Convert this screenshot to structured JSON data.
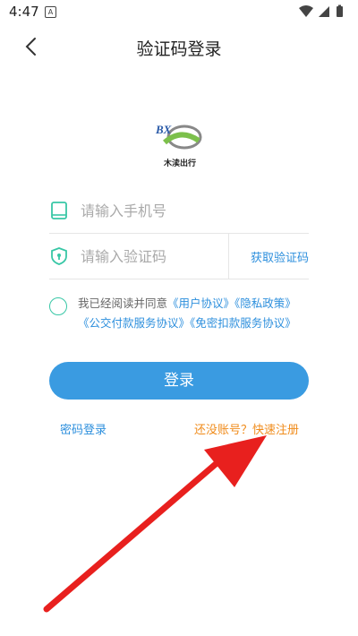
{
  "status_bar": {
    "time": "4:47",
    "notification_glyph": "A"
  },
  "header": {
    "title": "验证码登录"
  },
  "logo": {
    "text": "木渎出行",
    "letters": "BX"
  },
  "phone_field": {
    "placeholder": "请输入手机号",
    "value": ""
  },
  "code_field": {
    "placeholder": "请输入验证码",
    "value": ""
  },
  "get_code_label": "获取验证码",
  "agreement": {
    "prefix": "我已经阅读并同意",
    "user_agreement": "《用户协议》",
    "privacy_policy": "《隐私政策》",
    "bus_payment_agreement": "《公交付款服务协议》",
    "password_free_agreement": "《免密扣款服务协议》",
    "checked": false
  },
  "login_button": "登录",
  "password_login_link": "密码登录",
  "register_link": "还没账号？快速注册",
  "colors": {
    "accent_blue": "#3a9be1",
    "link_blue": "#2d8fdd",
    "register_orange": "#f08c1c",
    "check_green": "#38c7a6",
    "arrow_red": "#e8201e"
  }
}
